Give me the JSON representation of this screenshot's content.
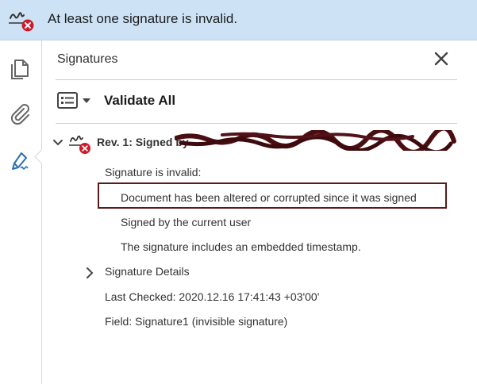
{
  "banner": {
    "message": "At least one signature is invalid.",
    "background": "#cde3f5"
  },
  "left_toolbar": {
    "tools": [
      {
        "name": "pages",
        "icon": "pages-icon"
      },
      {
        "name": "attachments",
        "icon": "paperclip-icon"
      },
      {
        "name": "signatures",
        "icon": "signature-pen-icon",
        "active": true
      }
    ],
    "accent": "#2a6fb0"
  },
  "panel": {
    "title": "Signatures",
    "validate_all_label": "Validate All",
    "revision": {
      "label": "Rev. 1: Signed by",
      "status_heading": "Signature is invalid:",
      "details": [
        "Document has been altered or corrupted since it was signed",
        "Signed by the current user",
        "The signature includes an embedded timestamp."
      ],
      "signature_details_label": "Signature Details",
      "last_checked": "Last Checked: 2020.12.16 17:41:43 +03'00'",
      "field": "Field: Signature1 (invisible signature)"
    },
    "error_color": "#d0192b",
    "highlight_border": "#5a1a1a"
  }
}
